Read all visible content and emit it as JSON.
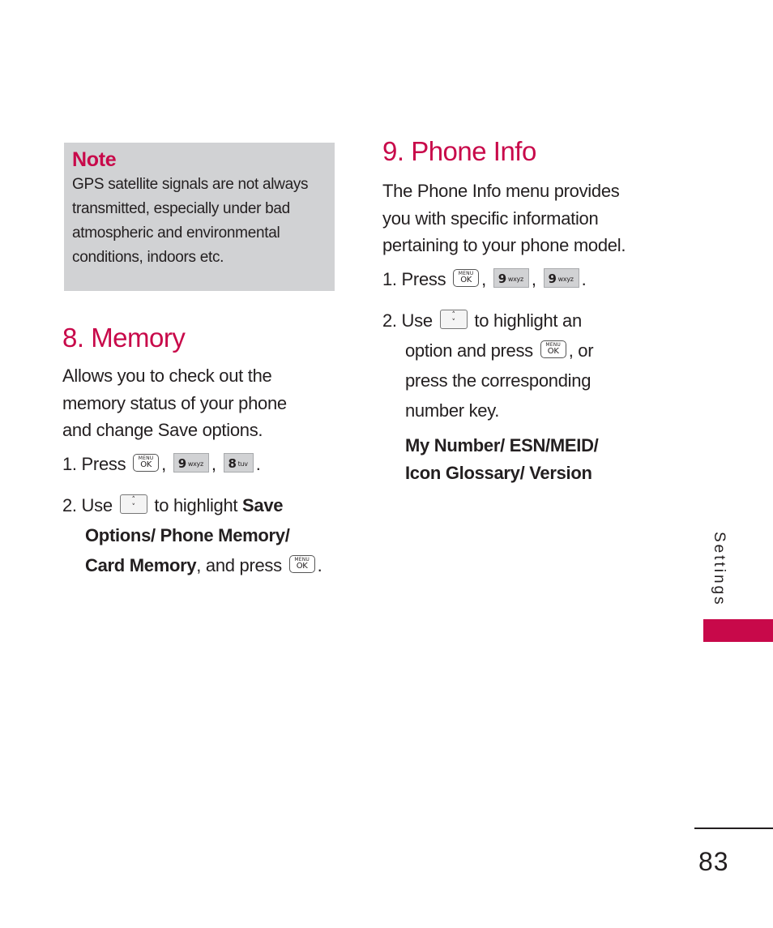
{
  "note": {
    "title": "Note",
    "lines": [
      "GPS satellite signals are not always",
      "transmitted, especially under bad",
      "atmospheric and environmental",
      "conditions, indoors etc."
    ]
  },
  "memory": {
    "heading": "8. Memory",
    "desc_lines": [
      "Allows you to check out the",
      "memory status of your phone",
      "and change Save options."
    ],
    "step1": {
      "prefix": "1. Press",
      "sep": ",",
      "end": "."
    },
    "step2": {
      "prefix": "2. Use",
      "text1": "to highlight",
      "bold1": "Save",
      "bold2": "Options/ Phone Memory/",
      "bold3": "Card Memory",
      "text2": ", and press",
      "end": "."
    }
  },
  "phone_info": {
    "heading": "9. Phone Info",
    "desc_lines": [
      "The Phone Info menu provides",
      "you with specific information",
      "pertaining to your phone model."
    ],
    "step1": {
      "prefix": "1. Press",
      "sep": ",",
      "end": "."
    },
    "step2": {
      "prefix": "2. Use",
      "text1": "to highlight an",
      "line2a": "option and press",
      "line2b": ", or",
      "line3": "press the corresponding",
      "line4": "number key."
    },
    "options_line1": "My Number/ ESN/MEID/",
    "options_line2": "Icon Glossary/ Version"
  },
  "keys": {
    "menu_top": "MENU",
    "menu_bottom": "OK",
    "nine_num": "9",
    "nine_letters": "wxyz",
    "eight_num": "8",
    "eight_letters": "tuv",
    "nav_up": "˄",
    "nav_down": "˅"
  },
  "side_tab": {
    "label": "Settings",
    "color": "#c8094a"
  },
  "page_number": "83",
  "colors": {
    "accent": "#c8094a",
    "note_bg": "#d1d2d4",
    "text": "#231f20"
  }
}
